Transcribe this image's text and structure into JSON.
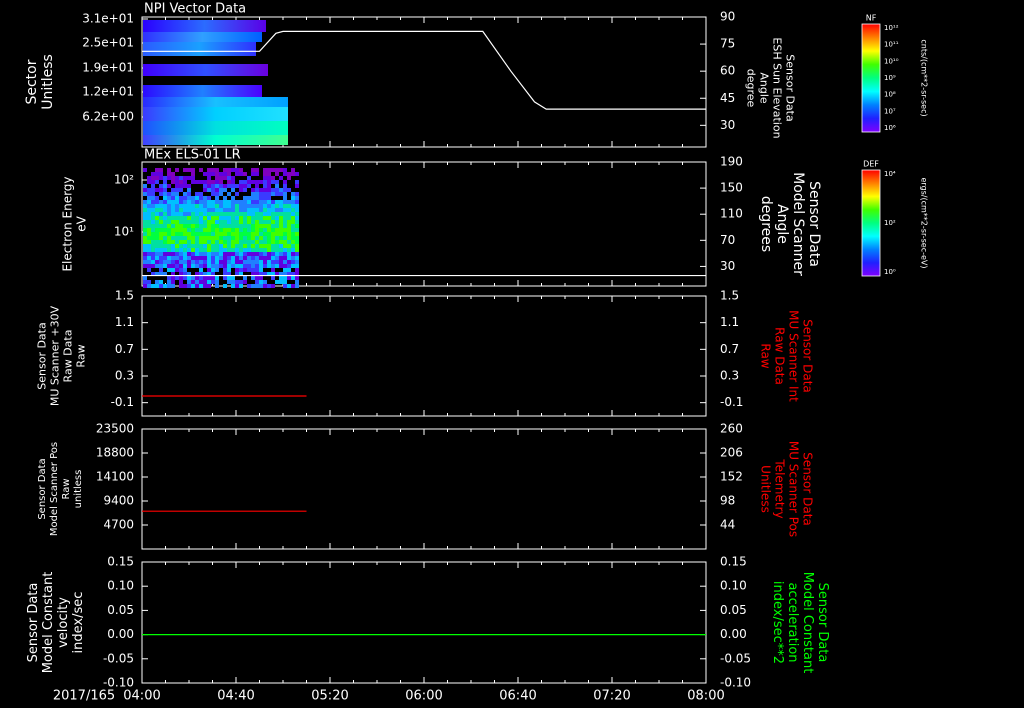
{
  "time_axis": {
    "date_label": "2017/165",
    "ticks": [
      "04:00",
      "04:40",
      "05:20",
      "06:00",
      "06:40",
      "07:20",
      "08:00"
    ]
  },
  "colors": {
    "background": "#000000",
    "axes": "#ffffff",
    "red_series": "#ff0000",
    "green_series": "#00ff00"
  },
  "colorbars": [
    {
      "title": "NF",
      "unit": "cnts/(cm**2-sr-sec)",
      "ticks": [
        "10¹²",
        "10¹¹",
        "10¹⁰",
        "10⁹",
        "10⁸",
        "10⁷",
        "10⁶"
      ]
    },
    {
      "title": "DEF",
      "unit": "ergs/(cm**2-sr-sec-eV)",
      "ticks": [
        "10⁴",
        "10²",
        "10⁰"
      ]
    }
  ],
  "chart_data": [
    {
      "type": "heatmap",
      "title": "NPI Vector Data",
      "ylabel": [
        "Sector",
        "Unitless"
      ],
      "y_ticks": [
        "3.1e+01",
        "2.5e+01",
        "1.9e+01",
        "1.2e+01",
        "6.2e+00"
      ],
      "right_series": {
        "type": "line",
        "ylabel": [
          "Sensor Data",
          "ESH Sun Elevation",
          "Angle",
          "degree"
        ],
        "ylim": [
          18,
          90
        ],
        "y_ticks": [
          30,
          45,
          60,
          75,
          90
        ],
        "x": [
          "04:00",
          "04:50",
          "04:57",
          "05:00",
          "06:25",
          "06:37",
          "06:47",
          "06:52",
          "08:00"
        ],
        "y": [
          71,
          71,
          81,
          82,
          82,
          60,
          43,
          39,
          39
        ]
      }
    },
    {
      "type": "heatmap",
      "title": "MEx ELS-01 LR",
      "ylabel": [
        "Electron Energy",
        "eV"
      ],
      "y_ticks": [
        "10²",
        "10¹"
      ],
      "right_series": {
        "type": "line",
        "ylabel": [
          "Sensor Data",
          "Model Scanner",
          "Angle",
          "degrees"
        ],
        "ylim": [
          0,
          190
        ],
        "y_ticks": [
          30,
          70,
          110,
          150,
          190
        ],
        "x": [
          "04:00",
          "08:00"
        ],
        "y": [
          16,
          16
        ]
      }
    },
    {
      "type": "line",
      "ylabel": [
        "Sensor Data",
        "MU Scanner +30V",
        "Raw Data",
        "Raw"
      ],
      "right_label": [
        "Sensor Data",
        "MU Scanner Int",
        "Raw Data",
        "Raw"
      ],
      "ylim": [
        -0.3,
        1.5
      ],
      "y_ticks": [
        "-0.1",
        "0.3",
        "0.7",
        "1.1",
        "1.5"
      ],
      "right_ticks": [
        "-0.1",
        "0.3",
        "0.7",
        "1.1",
        "1.5"
      ],
      "series": [
        {
          "x": [
            "04:00",
            "05:10"
          ],
          "y": [
            0.0,
            0.0
          ]
        }
      ]
    },
    {
      "type": "line",
      "ylabel": [
        "Sensor Data",
        "Model Scanner Pos",
        "Raw",
        "unitless"
      ],
      "right_label": [
        "Sensor Data",
        "MU Scanner Pos",
        "Telemetry",
        "Unitless"
      ],
      "ylim": [
        0,
        23500
      ],
      "y_ticks": [
        "4700",
        "9400",
        "14100",
        "18800",
        "23500"
      ],
      "right_ticks": [
        "44",
        "98",
        "152",
        "206",
        "260"
      ],
      "series": [
        {
          "x": [
            "04:00",
            "05:10"
          ],
          "y": [
            7400,
            7400
          ]
        }
      ]
    },
    {
      "type": "line",
      "ylabel": [
        "Sensor Data",
        "Model Constant",
        "velocity",
        "index/sec"
      ],
      "right_label": [
        "Sensor Data",
        "Model Constant",
        "acceleration",
        "index/sec**2"
      ],
      "ylim": [
        -0.1,
        0.15
      ],
      "y_ticks": [
        "-0.10",
        "-0.05",
        "0.00",
        "0.05",
        "0.10",
        "0.15"
      ],
      "right_ticks": [
        "-0.10",
        "-0.05",
        "0.00",
        "0.05",
        "0.10",
        "0.15"
      ],
      "series": [
        {
          "x": [
            "04:00",
            "08:00"
          ],
          "y": [
            0.0,
            0.0
          ]
        }
      ]
    }
  ]
}
